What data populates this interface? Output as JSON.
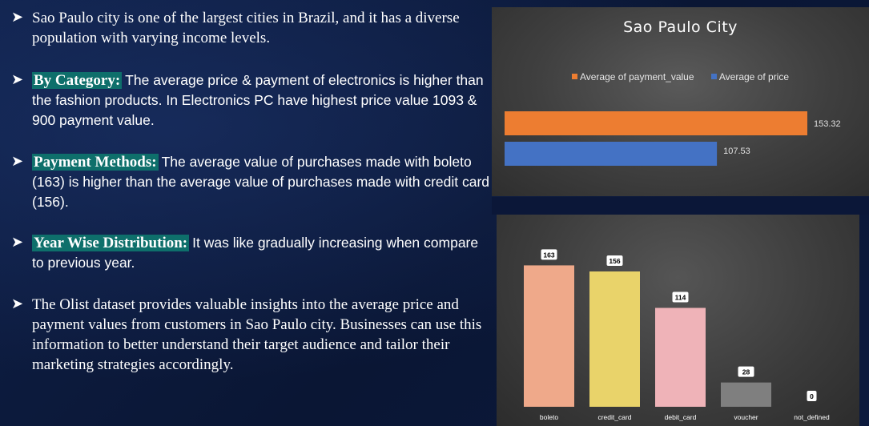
{
  "bullets": [
    {
      "text": "Sao Paulo city is one of the largest cities in Brazil, and it has a diverse population with varying income levels."
    },
    {
      "heading": "By Category:",
      "text": "The average price & payment of electronics is higher than the fashion products. In Electronics PC have highest price value 1093 & 900 payment value."
    },
    {
      "heading": "Payment Methods:",
      "text": "The average value of purchases made with boleto (163) is higher than the average value of purchases made with credit card (156)."
    },
    {
      "heading": "Year Wise Distribution:",
      "text": "It was like gradually increasing when compare to previous year."
    },
    {
      "text": "The Olist dataset provides valuable insights into the average price and payment values from customers in Sao Paulo city. Businesses can use this information to better understand their target audience and tailor their marketing strategies accordingly."
    }
  ],
  "chart_data": [
    {
      "type": "bar",
      "orientation": "horizontal",
      "title": "Sao Paulo City",
      "legend_position": "top",
      "series": [
        {
          "name": "Average of payment_value",
          "values": [
            153.32
          ],
          "color": "#ed7d31"
        },
        {
          "name": "Average of price",
          "values": [
            107.53
          ],
          "color": "#4472c4"
        }
      ],
      "data_labels": [
        "153.32",
        "107.53"
      ],
      "grid": false
    },
    {
      "type": "bar",
      "orientation": "vertical",
      "categories": [
        "boleto",
        "credit_card",
        "debit_card",
        "voucher",
        "not_defined"
      ],
      "values": [
        163,
        156,
        114,
        28,
        0
      ],
      "colors": [
        "#efa98a",
        "#e9d36a",
        "#efb3b8",
        "#7f7f7f",
        "#7f7f7f"
      ],
      "ylim": [
        0,
        180
      ],
      "grid": false
    }
  ]
}
